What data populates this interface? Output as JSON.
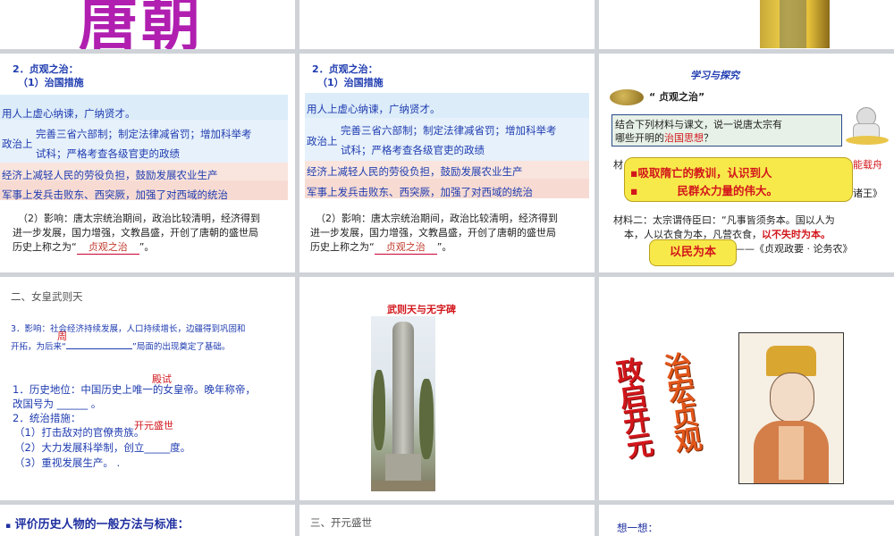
{
  "slide1": {
    "big_title": "唐朝"
  },
  "slide4": {
    "heading": "2．贞观之治：",
    "sub": "（1）治国措施",
    "row1": "用人上虚心纳谏，广纳贤才。",
    "row2_label": "政治上",
    "row2_a": "完善三省六部制；制定法律减省罚；增加科举考",
    "row2_b": "试科；严格考查各级官吏的政绩",
    "row3": "经济上减轻人民的劳役负担，鼓励发展农业生产",
    "row4": "军事上发兵击败东、西突厥，加强了对西域的统治",
    "impact1": "（2）影响：唐太宗统治期间，政治比较清明，经济得到",
    "impact2": "进一步发展，国力增强，文教昌盛，开创了唐朝的盛世局",
    "impact3_pre": "历史上称之为“",
    "impact3_fill": "贞观之治",
    "impact3_post": "”。"
  },
  "slide5": {
    "heading": "2．贞观之治：",
    "sub": "（1）治国措施",
    "row1": "用人上虚心纳谏，广纳贤才。",
    "row2_label": "政治上",
    "row2_a": "完善三省六部制；制定法律减省罚；增加科举考",
    "row2_b": "试科；严格考查各级官吏的政绩",
    "row3": "经济上减轻人民的劳役负担，鼓励发展农业生产",
    "row4": "军事上发兵击败东、西突厥，加强了对西域的统治",
    "impact1": "（2）影响：唐太宗统治期间，政治比较清明，经济得到",
    "impact2": "进一步发展，国力增强，文教昌盛，开创了唐朝的盛世局",
    "impact3_pre": "历史上称之为“",
    "impact3_fill": "贞观之治",
    "impact3_post": "”。"
  },
  "slide6": {
    "title": "学习与探究",
    "topic": "“ 贞观之治”",
    "prompt1": "结合下列材料与课文，说一说唐太宗有",
    "prompt2_pre": "哪些开明的",
    "prompt2_red": "治国思想",
    "prompt2_post": "？",
    "mat1_partial_left": "材",
    "mat1_partial_right": "能载舟",
    "mat1_end": "诸王》",
    "bubble_line1": "吸取隋亡的教训，认识到人",
    "bubble_line2": "民群众力量的伟大。",
    "mat2_line1": "材料二：太宗谓侍臣曰：“凡事皆须务本。国以人为",
    "mat2_line2_pre": "本，人以衣食为本，",
    "mat2_line2_mid": "凡营衣食，",
    "mat2_line2_red": "以不失时为本。",
    "mat2_source": "——《贞观政要 · 论务农》",
    "answer2": "以民为本"
  },
  "slide7": {
    "title": "二、女皇武则天",
    "impact_pre": "3．影响：",
    "impact_text": "社会经济持续发展，人口持续增长，边疆得到巩固和",
    "impact_text2": "开拓，为后来“",
    "impact_text3": "”局面的出现奠定了基础。",
    "float_zhou": "周",
    "float_dianshi": "殿试",
    "float_kaiyuan": "开元盛世",
    "pos1": "1．历史地位：中国历史上唯一的女皇帝。晚年称帝，",
    "pos2": "改国号为 ______ 。",
    "m_head": "2．统治措施：",
    "m1": "（1）打击敌对的官僚贵族。",
    "m2": "（2）大力发展科举制，创立_____度。",
    "m3": "（3）重视发展生产。  ."
  },
  "slide8": {
    "caption": "武则天与无字碑"
  },
  "slide9": {
    "art_right": "政启开元",
    "art_left": "治宏贞观"
  },
  "slide10": {
    "text": "评价历史人物的一般方法与标准："
  },
  "slide11": {
    "text": "三、开元盛世"
  },
  "slide12": {
    "text": "想一想："
  }
}
